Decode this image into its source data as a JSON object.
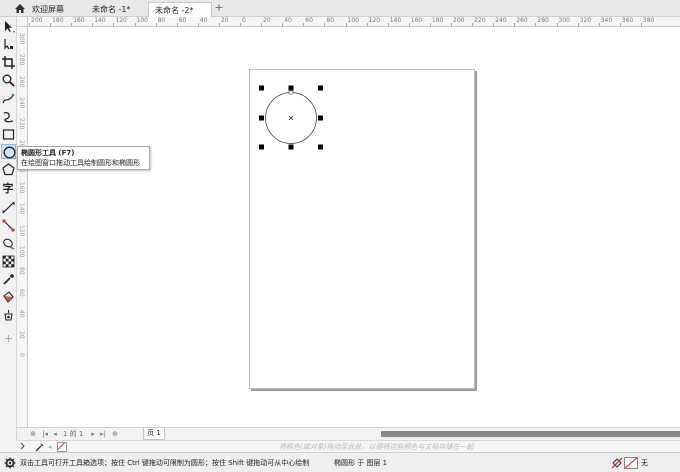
{
  "tabs": [
    {
      "label": "欢迎屏幕",
      "active": false
    },
    {
      "label": "未命名 -1*",
      "active": false
    },
    {
      "label": "未命名 -2*",
      "active": true
    }
  ],
  "rulers": {
    "horizontal_labels": [
      "200",
      "180",
      "160",
      "140",
      "120",
      "100",
      "80",
      "60",
      "40",
      "20",
      "0",
      "20",
      "40",
      "60",
      "80",
      "100",
      "120",
      "140",
      "160",
      "180",
      "200",
      "220",
      "240",
      "260",
      "280",
      "300",
      "320",
      "340",
      "360",
      "380"
    ],
    "vertical_labels": [
      "300",
      "280",
      "260",
      "240",
      "220",
      "200",
      "180",
      "160",
      "140",
      "120",
      "100",
      "80",
      "60",
      "40",
      "20",
      "0"
    ]
  },
  "tools": [
    {
      "name": "pick-tool-icon"
    },
    {
      "name": "shape-tool-icon"
    },
    {
      "name": "crop-tool-icon"
    },
    {
      "name": "zoom-tool-icon"
    },
    {
      "name": "freehand-tool-icon"
    },
    {
      "name": "artistic-media-tool-icon"
    },
    {
      "name": "rectangle-tool-icon"
    },
    {
      "name": "ellipse-tool-icon"
    },
    {
      "name": "polygon-tool-icon"
    },
    {
      "name": "text-tool-icon"
    },
    {
      "name": "parallel-dimension-tool-icon"
    },
    {
      "name": "connector-tool-icon"
    },
    {
      "name": "drop-shadow-tool-icon"
    },
    {
      "name": "transparency-tool-icon"
    },
    {
      "name": "eyedropper-tool-icon"
    },
    {
      "name": "interactive-fill-tool-icon"
    },
    {
      "name": "smart-fill-tool-icon"
    },
    {
      "name": "add-tool-icon"
    }
  ],
  "tooltip": {
    "title": "椭圆形工具 (F7)",
    "description": "在绘图窗口拖动工具绘制圆形和椭圆形"
  },
  "navigation": {
    "page_of": "1 的 1",
    "page_tab": "页 1"
  },
  "colorbar": {
    "hint": "将颜色(或对象)拖动至此处，以便将这些颜色与文档存储在一起"
  },
  "status": {
    "hint": "双击工具可打开工具箱选项；按住 Ctrl 键拖动可限制为圆形；按住 Shift 键拖动可从中心绘制",
    "object": "椭圆形 于 图层 1",
    "fill": "无"
  },
  "colors": {
    "accent": "#2d6fc2",
    "tab_active_bg": "#ffffff",
    "none_fill": "#e0262c"
  }
}
